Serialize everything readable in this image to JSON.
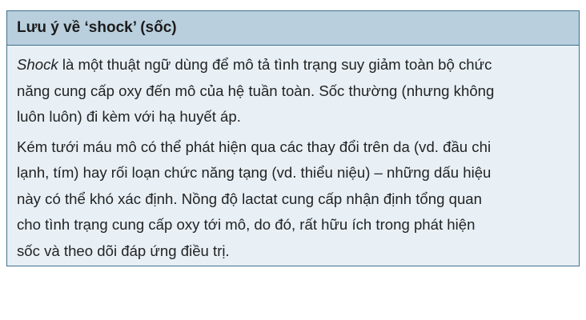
{
  "callout": {
    "title": "Lưu ý về ‘shock’ (sốc)",
    "paragraphs": [
      {
        "italic_term": "Shock",
        "lines": [
          " là một thuật ngữ dùng để mô tả tình trạng suy giảm toàn bộ chức",
          "năng cung cấp oxy đến mô của hệ tuần toàn. Sốc thường (nhưng không",
          "luôn luôn) đi kèm với hạ huyết áp."
        ]
      },
      {
        "lines": [
          "Kém tưới máu mô có thể phát hiện qua các thay đổi trên da (vd. đầu chi",
          "lạnh, tím) hay rối loạn chức năng tạng (vd. thiểu niệu) – những dấu hiệu",
          "này có thể khó xác định. Nồng độ lactat cung cấp nhận định tổng quan",
          "cho tình trạng cung cấp oxy tới mô, do đó, rất hữu ích trong phát hiện",
          "sốc và theo dõi đáp ứng điều trị."
        ]
      }
    ]
  },
  "colors": {
    "border": "#3f6f8c",
    "header_background": "#b9cfde",
    "body_background": "#e8f0f6"
  }
}
